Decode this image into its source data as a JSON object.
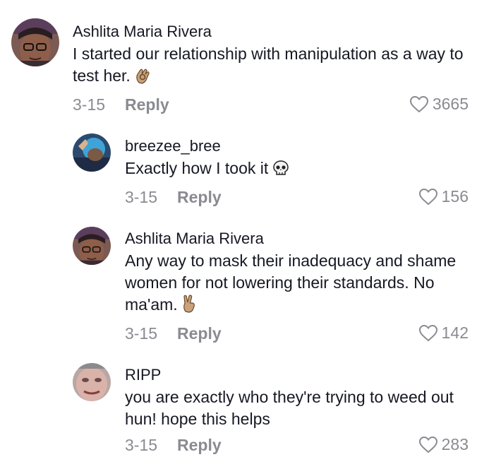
{
  "comments": [
    {
      "username": "Ashlita Maria Rivera",
      "text": "I started our relationship with manipulation as a way to test her.",
      "emoji": "ok-hand",
      "date": "3-15",
      "reply_label": "Reply",
      "likes": "3665"
    },
    {
      "username": "breezee_bree",
      "text": "Exactly how I took it",
      "emoji": "skull",
      "date": "3-15",
      "reply_label": "Reply",
      "likes": "156"
    },
    {
      "username": "Ashlita Maria Rivera",
      "text": "Any way to mask their inadequacy and shame women for not lowering their standards. No ma'am.",
      "emoji": "victory-hand",
      "date": "3-15",
      "reply_label": "Reply",
      "likes": "142"
    },
    {
      "username": "RIPP",
      "text": "you are exactly who they're trying to weed out hun! hope this helps",
      "emoji": "",
      "date": "3-15",
      "reply_label": "Reply",
      "likes": "283"
    }
  ],
  "icons": {
    "like": "heart-outline-icon"
  },
  "colors": {
    "text": "#161823",
    "muted": "#8a8b91"
  }
}
